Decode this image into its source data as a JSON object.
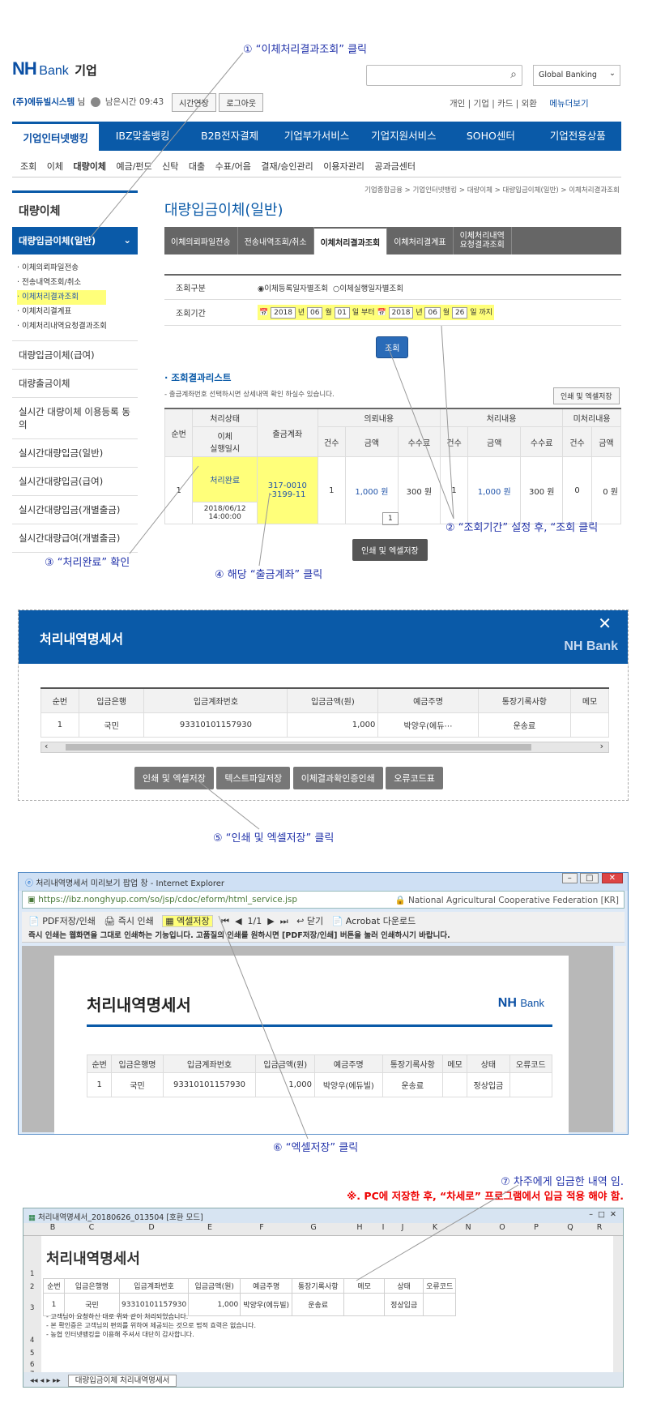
{
  "annotations": {
    "step1": "① “이체처리결과조회” 클릭",
    "step2": "② “조회기간” 설정 후, “조회 클릭",
    "step3": "③ “처리완료” 확인",
    "step4": "④ 해당 “출금계좌” 클릭",
    "step5": "⑤ “인쇄 및 엑셀저장” 클릭",
    "step6": "⑥ “엑셀저장” 클릭",
    "step7": "⑦ 차주에게 입금한 내역 임.",
    "note": "※. PC에 저장한 후, “차세로” 프로그램에서 입금 적용 해야 함."
  },
  "header": {
    "logo_nh": "NH",
    "logo_bank": "Bank",
    "logo_corp": "기업",
    "user": "(주)에듀빌시스템",
    "user_suffix": "님",
    "remaining_time": "남은시간 09:43",
    "extend_button": "시간연장",
    "logout_button": "로그아웃",
    "global_banking": "Global Banking",
    "util_links": [
      "개인",
      "기업",
      "카드",
      "외환"
    ],
    "menu_all": "메뉴더보기"
  },
  "gnb": [
    "기업인터넷뱅킹",
    "IBZ맞춤뱅킹",
    "B2B전자결제",
    "기업부가서비스",
    "기업지원서비스",
    "SOHO센터",
    "기업전용상품"
  ],
  "subnav": [
    "조회",
    "이체",
    "대량이체",
    "예금/펀드",
    "신탁",
    "대출",
    "수표/어음",
    "결재/승인관리",
    "이용자관리",
    "공과금센터"
  ],
  "breadcrumb": "기업종합금융 > 기업인터넷뱅킹 > 대량이체 > 대량입금이체(일반) > 이체처리결과조회",
  "sidebar": {
    "title": "대량이체",
    "active": "대량입금이체(일반)",
    "subitems": [
      "이체의뢰파일전송",
      "전송내역조회/취소",
      "이체처리결과조회",
      "이체처리결계표",
      "이체처리내역요청결과조회"
    ],
    "items": [
      "대량입금이체(급여)",
      "대량출금이체",
      "실시간 대량이체 이용등록 동의",
      "실시간대량입금(일반)",
      "실시간대량입금(급여)",
      "실시간대량입금(개별출금)",
      "실시간대량급여(개별출금)"
    ]
  },
  "page": {
    "title": "대량입금이체(일반)",
    "tabs": [
      "이체의뢰파일전송",
      "전송내역조회/취소",
      "이체처리결과조회",
      "이체처리결계표",
      "이체처리내역\n요청결과조회"
    ],
    "search_type_label": "조회구분",
    "radio1": "이체등록일자별조회",
    "radio2": "이체실행일자별조회",
    "period_label": "조회기간",
    "from": {
      "year": "2018",
      "month": "06",
      "day": "01"
    },
    "to": {
      "year": "2018",
      "month": "06",
      "day": "26"
    },
    "unit_year": "년",
    "unit_month": "월",
    "unit_day": "일",
    "from_text": "부터",
    "to_text": "까지",
    "search_button": "조회",
    "result_title": "조회결과리스트",
    "result_desc": "- 출금계좌번호 선택하시면 상세내역 확인 하실수 있습니다.",
    "print_excel_button": "인쇄 및 엑셀저장",
    "table_headers": {
      "seq": "순번",
      "status": "처리상태",
      "exec": "이체\n실행일시",
      "account": "출금계좌",
      "req": "의뢰내용",
      "proc": "처리내용",
      "unproc": "미처리내용",
      "count": "건수",
      "amount": "금액",
      "fee": "수수료"
    },
    "row": {
      "seq": "1",
      "status": "처리완료",
      "datetime": "2018/06/12\n14:00:00",
      "account": "317-0010\n-3199-11",
      "req_count": "1",
      "req_amount": "1,000 원",
      "req_fee": "300 원",
      "proc_count": "1",
      "proc_amount": "1,000 원",
      "proc_fee": "300 원",
      "un_count": "0",
      "un_amount": "0 원"
    },
    "page_number": "1",
    "bottom_button": "인쇄 및 엑셀저장"
  },
  "modal": {
    "title": "처리내역명세서",
    "logo": "NH Bank",
    "headers": [
      "순번",
      "입금은행",
      "입금계좌번호",
      "입금금액(원)",
      "예금주명",
      "통장기록사항",
      "메모"
    ],
    "row": [
      "1",
      "국민",
      "93310101157930",
      "1,000",
      "박양우(에듀⋯",
      "운송료",
      ""
    ],
    "buttons": [
      "인쇄 및 엑셀저장",
      "텍스트파일저장",
      "이체결과확인증인쇄",
      "오류코드표"
    ]
  },
  "ie": {
    "title": "처리내역명세서 미리보기 팝업 창 - Internet Explorer",
    "url": "https://ibz.nonghyup.com/so/jsp/cdoc/eform/html_service.jsp",
    "cert": "National Agricultural Cooperative Federation [KR]",
    "toolbar": [
      "PDF저장/인쇄",
      "즉시 인쇄",
      "엑셀저장",
      "1/1",
      "닫기",
      "Acrobat 다운로드"
    ],
    "notice": "즉시 인쇄는 웹화면을 그대로 인쇄하는 기능입니다. 고품질의 인쇄를 원하시면 [PDF저장/인쇄] 버튼을 눌러 인쇄하시기 바랍니다.",
    "doc_title": "처리내역명세서",
    "headers": [
      "순번",
      "입금은행명",
      "입금계좌번호",
      "입금금액(원)",
      "예금주명",
      "통장기록사항",
      "메모",
      "상태",
      "오류코드"
    ],
    "row": [
      "1",
      "국민",
      "93310101157930",
      "1,000",
      "박양우(에듀빌)",
      "운송료",
      "",
      "정상입금",
      ""
    ]
  },
  "excel": {
    "title": "처리내역명세서_20180626_013504 [호환 모드]",
    "cols": [
      "B",
      "C",
      "D",
      "E",
      "F",
      "G",
      "H",
      "I",
      "J",
      "K",
      "N",
      "O",
      "P",
      "Q",
      "R"
    ],
    "doc_title": "처리내역명세서",
    "headers": [
      "순번",
      "입금은행명",
      "입금계좌번호",
      "입금금액(원)",
      "예금주명",
      "통장기록사항",
      "메모",
      "상태",
      "오류코드"
    ],
    "row": [
      "1",
      "국민",
      "93310101157930",
      "1,000",
      "박양우(에듀빌)",
      "운송료",
      "",
      "정상입금",
      ""
    ],
    "notes": [
      "- 고객님이 요청하신 대로 위와 같이 처리되었습니다.",
      "- 본 확인증은 고객님의 편의를 위하여 제공되는 것으로 법적 효력은 없습니다.",
      "- 농협 인터넷뱅킹을 이용해 주셔서 대단히 감사합니다."
    ],
    "sheet_tab": "대량입금이체 처리내역명세서",
    "row_numbers": [
      "1",
      "2",
      "3",
      "4",
      "5",
      "6",
      "7"
    ]
  }
}
